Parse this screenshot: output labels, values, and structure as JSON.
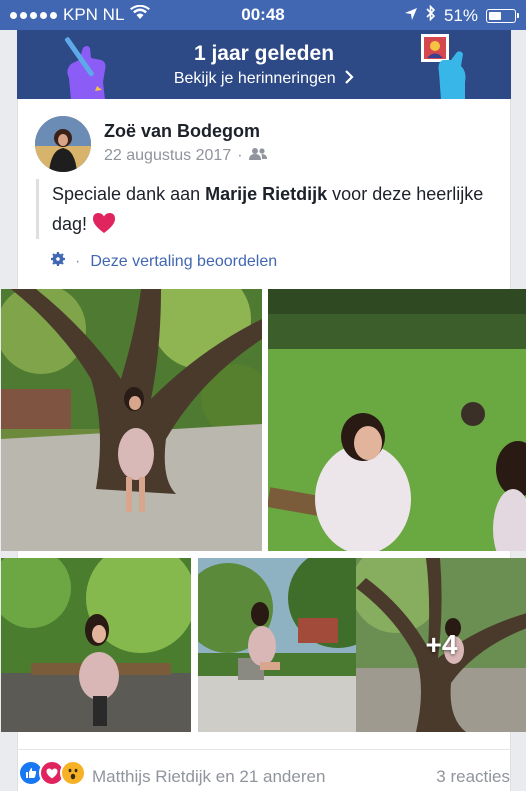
{
  "statusbar": {
    "carrier": "KPN NL",
    "time": "00:48",
    "battery": "51%",
    "battery_level": 0.51
  },
  "memories": {
    "title": "1 jaar geleden",
    "subtitle": "Bekijk je herinneringen"
  },
  "post": {
    "author": "Zoë van Bodegom",
    "date": "22 augustus 2017",
    "text_before": "Speciale dank aan ",
    "text_tag": "Marije Rietdijk",
    "text_after": " voor deze heerlijke dag! ",
    "text_emoji": "❤️",
    "translate_link": "Deze vertaling beoordelen",
    "more_photos": "+4"
  },
  "footer": {
    "reacted_by": "Matthijs Rietdijk en 21 anderen",
    "comments": "3 reacties"
  },
  "colors": {
    "brand": "#4267b2",
    "banner": "#2e4a86",
    "heart": "#e0245e"
  }
}
